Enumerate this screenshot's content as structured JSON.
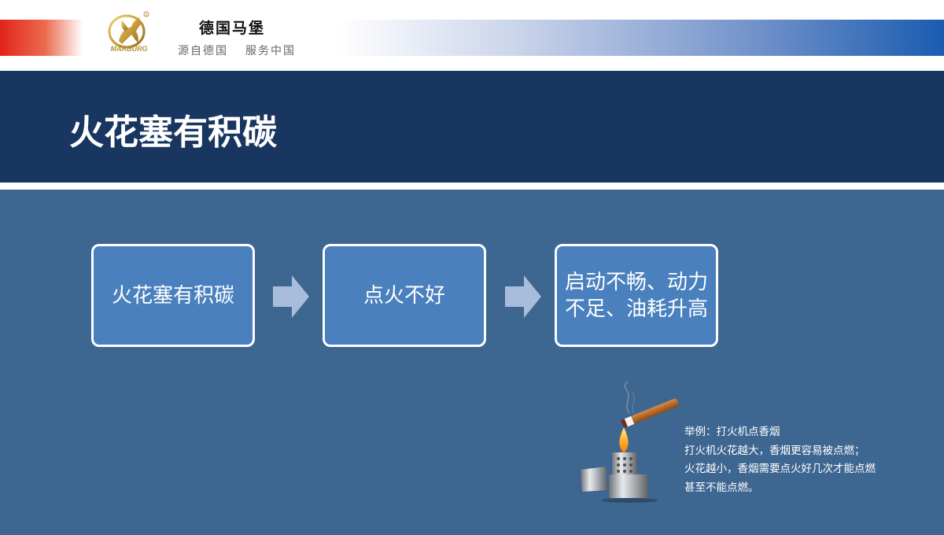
{
  "header": {
    "logo_text": "MARBURG",
    "brand_name": "德国马堡",
    "slogan": [
      "源自德国",
      "服务中国"
    ]
  },
  "title": "火花塞有积碳",
  "flow": [
    {
      "text": "火花塞有积碳"
    },
    {
      "text": "点火不好"
    },
    {
      "text": "启动不畅、动力不足、油耗升高"
    }
  ],
  "example": {
    "lines": [
      "举例：打火机点香烟",
      "打火机火花越大，香烟更容易被点燃；",
      "火花越小，香烟需要点火好几次才能点燃",
      "甚至不能点燃。"
    ]
  },
  "colors": {
    "title_band": "#183660",
    "content_bg": "#3d6691",
    "box_fill": "#4a80be",
    "arrow": "#a8bcdb"
  }
}
